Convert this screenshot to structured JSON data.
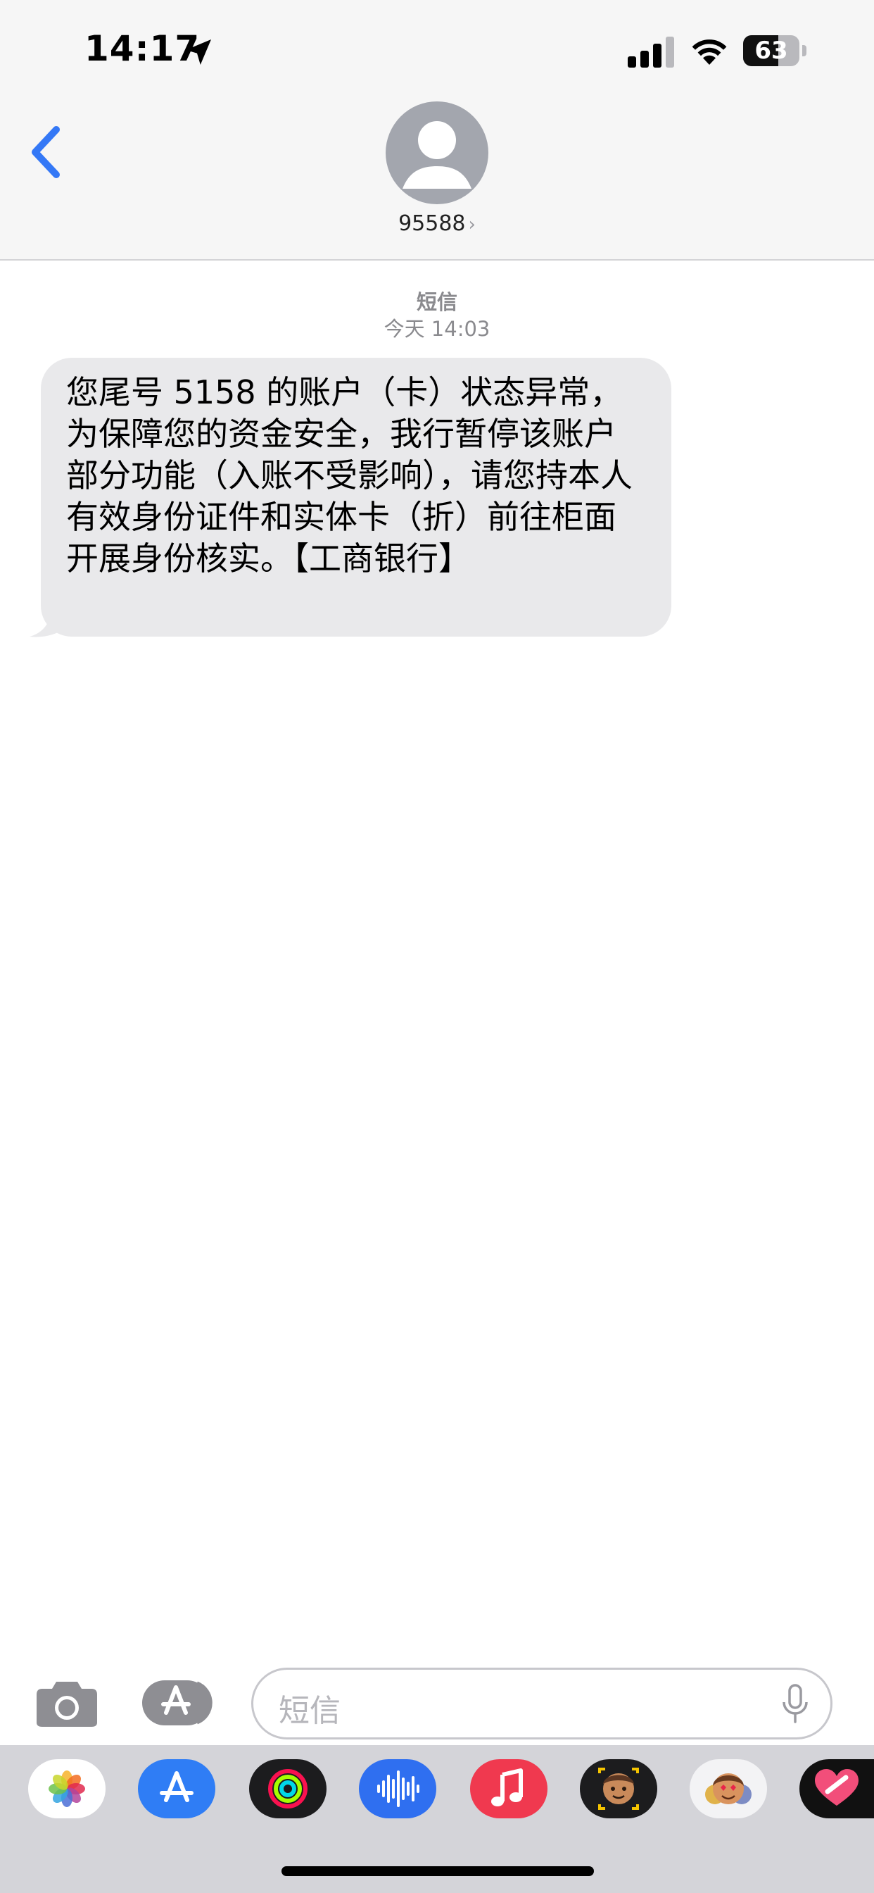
{
  "status_bar": {
    "time": "14:17",
    "battery_level": "63",
    "battery_fraction": 0.63
  },
  "header": {
    "contact_name": "95588",
    "chevron": "›",
    "back_icon": "chevron-left-icon",
    "avatar_icon": "person-icon"
  },
  "conversation": {
    "service_label": "短信",
    "timestamp": "今天 14:03",
    "messages": [
      {
        "direction": "incoming",
        "text": "您尾号 5158 的账户（卡）状态异常，为保障您的资金安全，我行暂停该账户部分功能（入账不受影响），请您持本人有效身份证件和实体卡（折）前往柜面开展身份核实。【工商银行】"
      }
    ]
  },
  "compose": {
    "placeholder": "短信",
    "camera_icon": "camera-icon",
    "apps_icon": "app-store-icon",
    "mic_icon": "microphone-icon"
  },
  "app_drawer": {
    "apps": [
      "Photos",
      "App Store",
      "Fitness",
      "Audio Message",
      "Music",
      "Memoji Stickers",
      "Animoji",
      "Digital Touch"
    ]
  },
  "colors": {
    "accent": "#3478f6",
    "bubble_incoming": "#e9e9eb",
    "header_bg": "#f6f6f6",
    "drawer_bg": "#d4d4d9"
  }
}
